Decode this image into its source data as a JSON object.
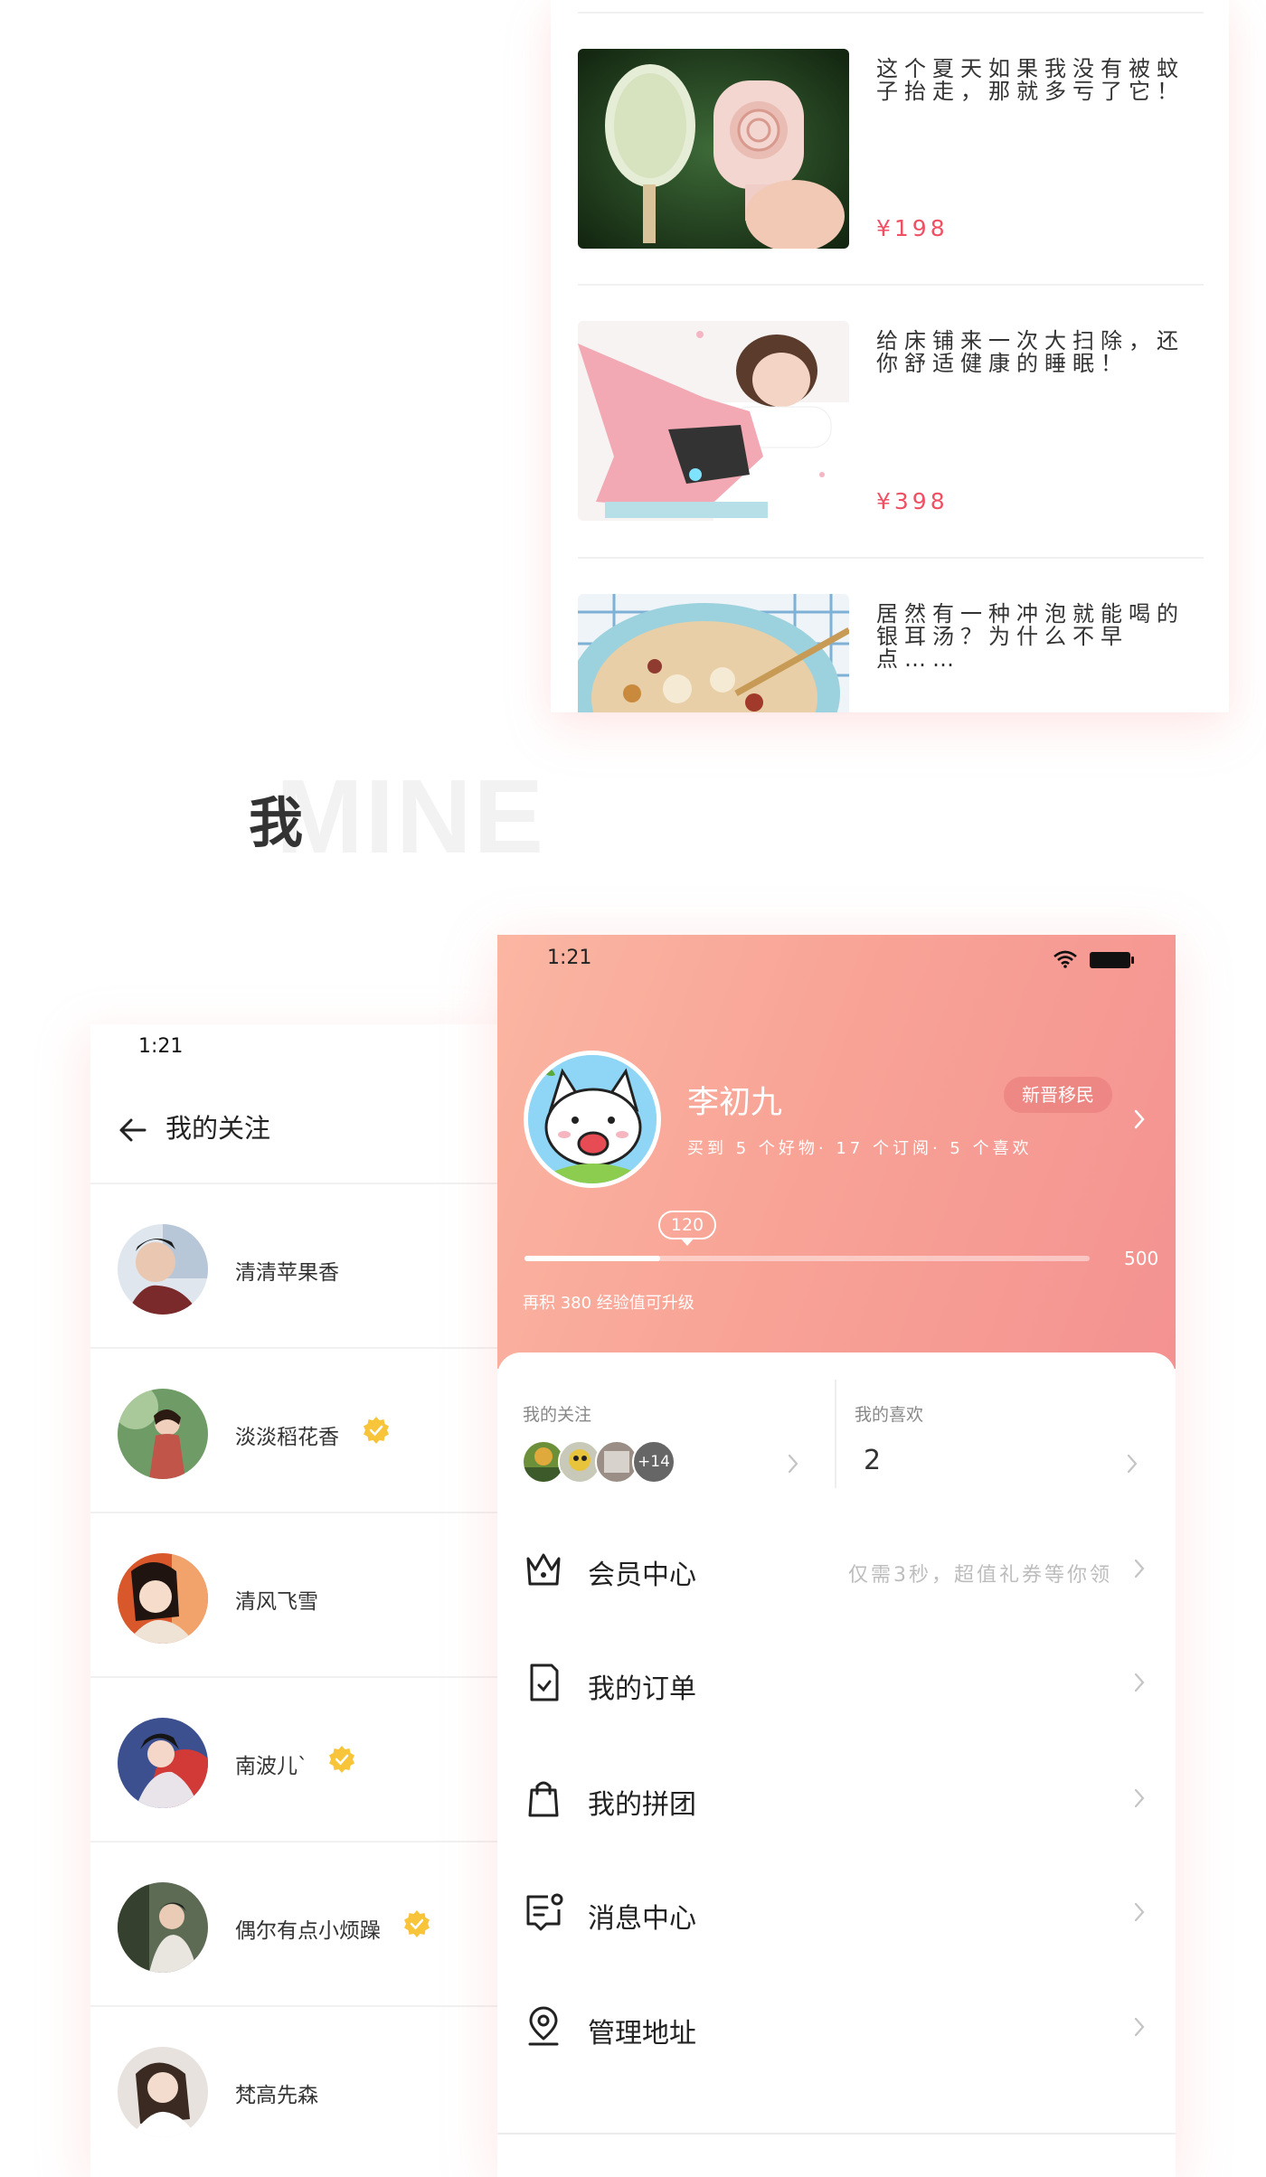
{
  "products": [
    {
      "title": "这个夏天如果我没有被蚊子抬走，那就多亏了它！",
      "price": "¥198",
      "image": "ice-cream-bug-zapper-photo"
    },
    {
      "title": "给床铺来一次大扫除，还你舒适健康的睡眠！",
      "price": "¥398",
      "image": "mite-vacuum-photo"
    },
    {
      "title": "居然有一种冲泡就能喝的银耳汤？为什么不早点……",
      "price": "",
      "image": "tremella-soup-photo"
    }
  ],
  "section": {
    "title": "我",
    "watermark": "MINE"
  },
  "following_screen": {
    "status_time": "1:21",
    "title": "我的关注",
    "users": [
      {
        "name": "清清苹果香",
        "verified": false
      },
      {
        "name": "淡淡稻花香",
        "verified": true
      },
      {
        "name": "清风飞雪",
        "verified": false
      },
      {
        "name": "南波儿`",
        "verified": true
      },
      {
        "name": "偶尔有点小烦躁",
        "verified": true
      },
      {
        "name": "梵高先森",
        "verified": false
      }
    ]
  },
  "profile": {
    "status_time": "1:21",
    "name": "李初九",
    "badge": "新晋移民",
    "stats_line": "买到 5 个好物· 17 个订阅· 5 个喜欢",
    "xp": {
      "current_label": "120",
      "max_label": "500",
      "note": "再积 380 经验值可升级",
      "progress": 0.24
    },
    "following_label": "我的关注",
    "following_more": "+14",
    "likes_label": "我的喜欢",
    "likes_count": "2",
    "menu": [
      {
        "label": "会员中心",
        "hint": "仅需3秒，超值礼券等你领",
        "icon": "crown-icon"
      },
      {
        "label": "我的订单",
        "hint": "",
        "icon": "order-icon"
      },
      {
        "label": "我的拼团",
        "hint": "",
        "icon": "shopping-bag-icon"
      },
      {
        "label": "消息中心",
        "hint": "",
        "icon": "message-icon"
      },
      {
        "label": "管理地址",
        "hint": "",
        "icon": "location-icon"
      }
    ]
  },
  "colors": {
    "accent": "#f49291",
    "price": "#ef5064",
    "verified": "#f8c53a"
  }
}
